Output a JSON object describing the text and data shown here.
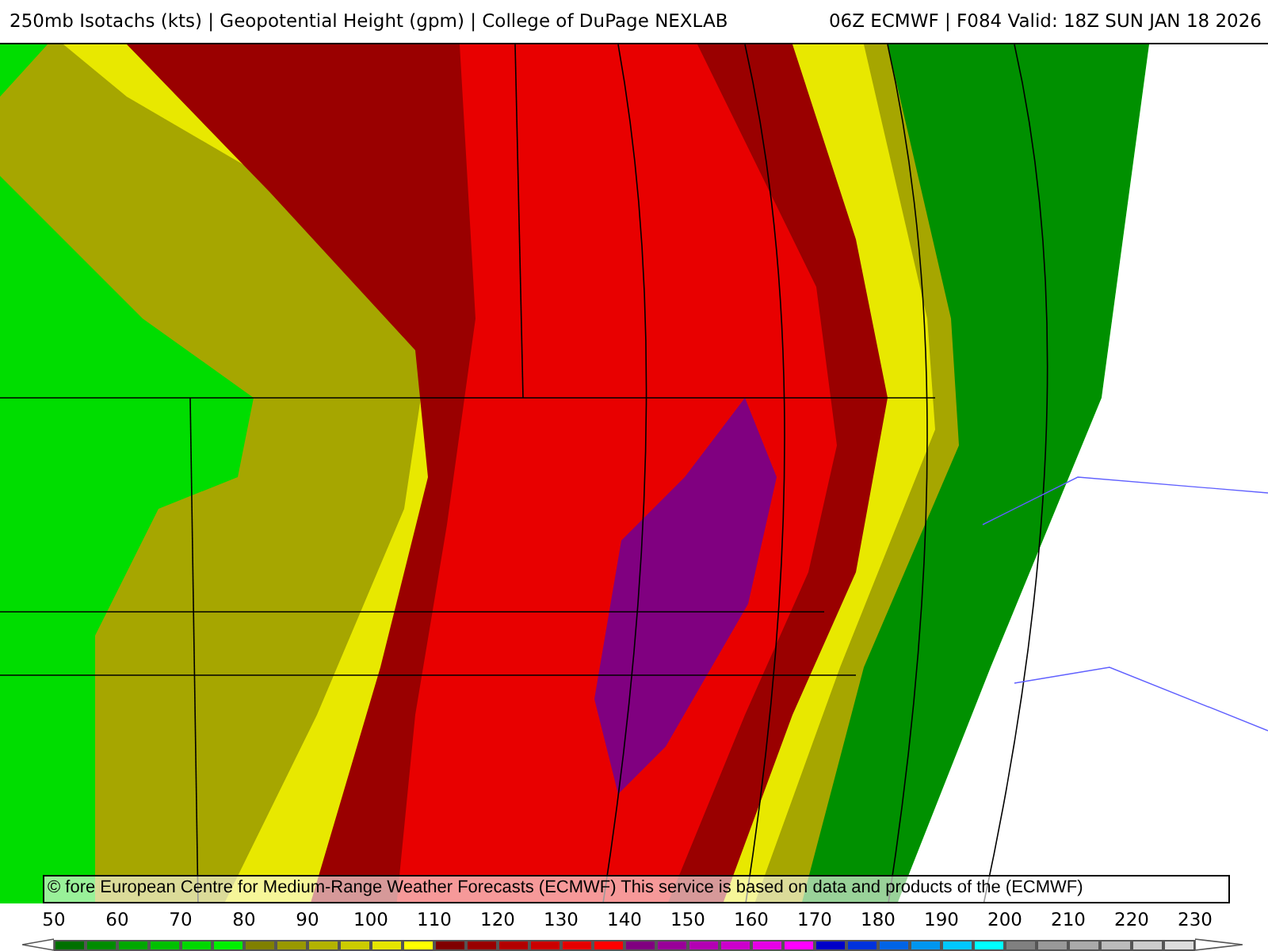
{
  "header": {
    "title": "250mb Isotachs (kts) | Geopotential Height (gpm) | College of DuPage NEXLAB",
    "run": "06Z ECMWF | F084 Valid: 18Z SUN JAN 18 2026"
  },
  "attribution": "© fore European Centre for Medium-Range Weather Forecasts (ECMWF) This service is based on data and products of the (ECMWF)",
  "legend": {
    "labels": [
      "50",
      "60",
      "70",
      "80",
      "90",
      "100",
      "110",
      "120",
      "130",
      "140",
      "150",
      "160",
      "170",
      "180",
      "190",
      "200",
      "210",
      "220",
      "230"
    ],
    "swatches": [
      {
        "color": "#007000"
      },
      {
        "color": "#008c00"
      },
      {
        "color": "#00a800"
      },
      {
        "color": "#00c000"
      },
      {
        "color": "#00d800"
      },
      {
        "color": "#00f000"
      },
      {
        "color": "#808000"
      },
      {
        "color": "#999900"
      },
      {
        "color": "#b3b300"
      },
      {
        "color": "#cccc00"
      },
      {
        "color": "#e6e600"
      },
      {
        "color": "#ffff00"
      },
      {
        "color": "#800000"
      },
      {
        "color": "#990000"
      },
      {
        "color": "#b30000"
      },
      {
        "color": "#cc0000"
      },
      {
        "color": "#e60000"
      },
      {
        "color": "#ff0000"
      },
      {
        "color": "#800080"
      },
      {
        "color": "#990099"
      },
      {
        "color": "#b300b3"
      },
      {
        "color": "#cc00cc"
      },
      {
        "color": "#e600e6"
      },
      {
        "color": "#ff00ff"
      },
      {
        "color": "#0000c8"
      },
      {
        "color": "#0032dc"
      },
      {
        "color": "#0064e6"
      },
      {
        "color": "#0096f0"
      },
      {
        "color": "#00c8ff"
      },
      {
        "color": "#00ffff"
      },
      {
        "color": "#808080"
      },
      {
        "color": "#999999"
      },
      {
        "color": "#aaaaaa"
      },
      {
        "color": "#bbbbbb"
      },
      {
        "color": "#cccccc"
      },
      {
        "color": "#dddddd"
      }
    ]
  }
}
